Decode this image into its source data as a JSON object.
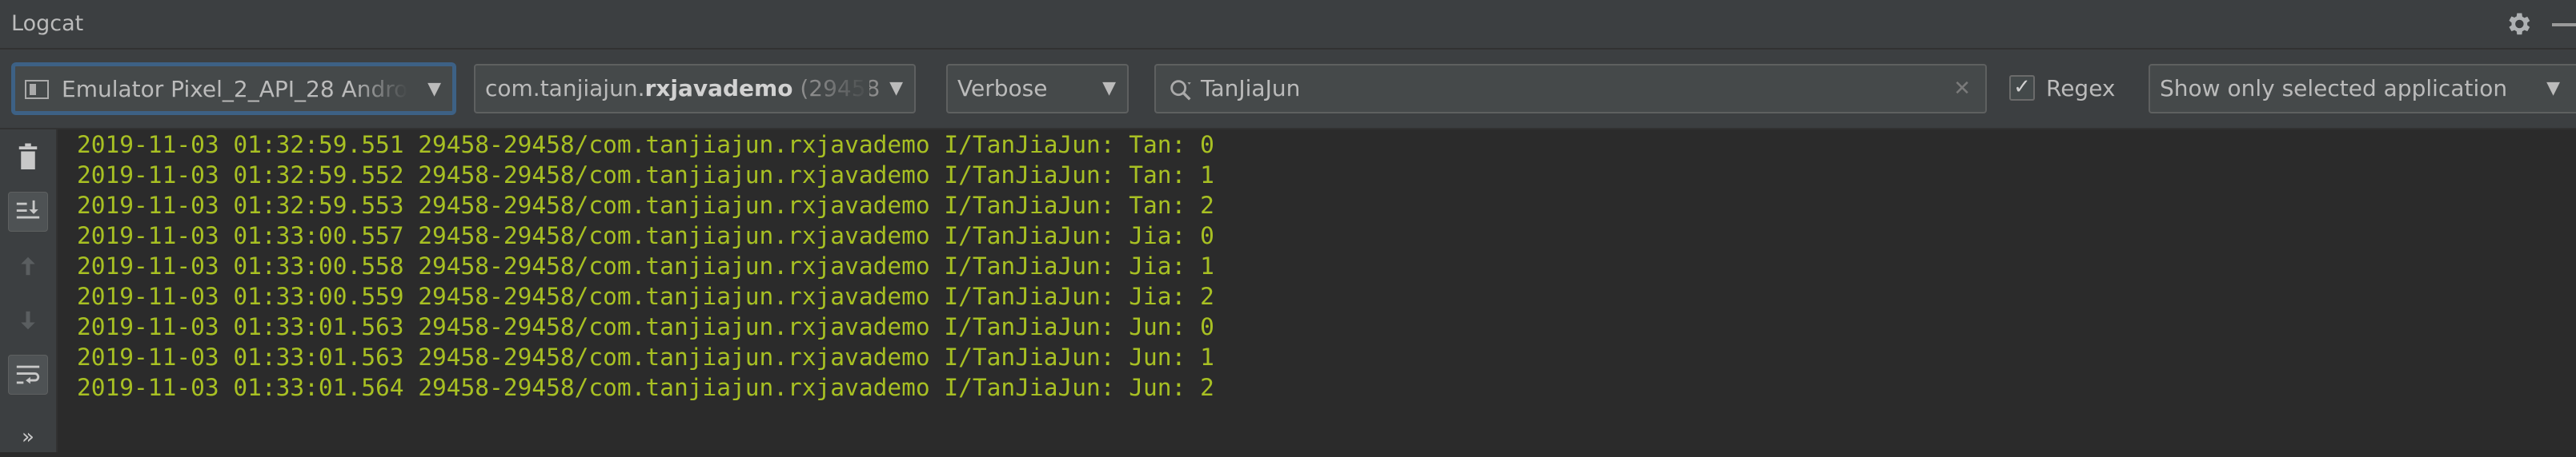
{
  "window": {
    "title": "Logcat"
  },
  "icons": {
    "settings": "gear-icon",
    "minimize": "minimize-icon",
    "device": "device-icon",
    "search": "search-icon",
    "clear": "clear-icon",
    "delete": "trash-icon",
    "scroll_to_end": "scroll-to-end-icon",
    "up": "arrow-up-icon",
    "down": "arrow-down-icon",
    "soft_wrap": "soft-wrap-icon",
    "more": "more-icon"
  },
  "toolbar": {
    "device": "Emulator Pixel_2_API_28 Andro",
    "process_package": "com.tanjiajun.",
    "process_app": "rxjavademo",
    "process_pid": " (29458",
    "log_level": "Verbose",
    "search_query": "TanJiaJun",
    "clear_glyph": "✕",
    "regex_checked": true,
    "regex_check_glyph": "✓",
    "regex_label": "Regex",
    "filter": "Show only selected application",
    "dropdown_glyph": "▼"
  },
  "sidebar": {
    "more_glyph": "»"
  },
  "log": {
    "lines": [
      "2019-11-03 01:32:59.551 29458-29458/com.tanjiajun.rxjavademo I/TanJiaJun: Tan: 0",
      "2019-11-03 01:32:59.552 29458-29458/com.tanjiajun.rxjavademo I/TanJiaJun: Tan: 1",
      "2019-11-03 01:32:59.553 29458-29458/com.tanjiajun.rxjavademo I/TanJiaJun: Tan: 2",
      "2019-11-03 01:33:00.557 29458-29458/com.tanjiajun.rxjavademo I/TanJiaJun: Jia: 0",
      "2019-11-03 01:33:00.558 29458-29458/com.tanjiajun.rxjavademo I/TanJiaJun: Jia: 1",
      "2019-11-03 01:33:00.559 29458-29458/com.tanjiajun.rxjavademo I/TanJiaJun: Jia: 2",
      "2019-11-03 01:33:01.563 29458-29458/com.tanjiajun.rxjavademo I/TanJiaJun: Jun: 0",
      "2019-11-03 01:33:01.563 29458-29458/com.tanjiajun.rxjavademo I/TanJiaJun: Jun: 1",
      "2019-11-03 01:33:01.564 29458-29458/com.tanjiajun.rxjavademo I/TanJiaJun: Jun: 2"
    ]
  },
  "colors": {
    "panel": "#3c3f41",
    "log_background": "#2b2b2b",
    "log_text": "#a8c023",
    "focus": "#3d6185"
  }
}
